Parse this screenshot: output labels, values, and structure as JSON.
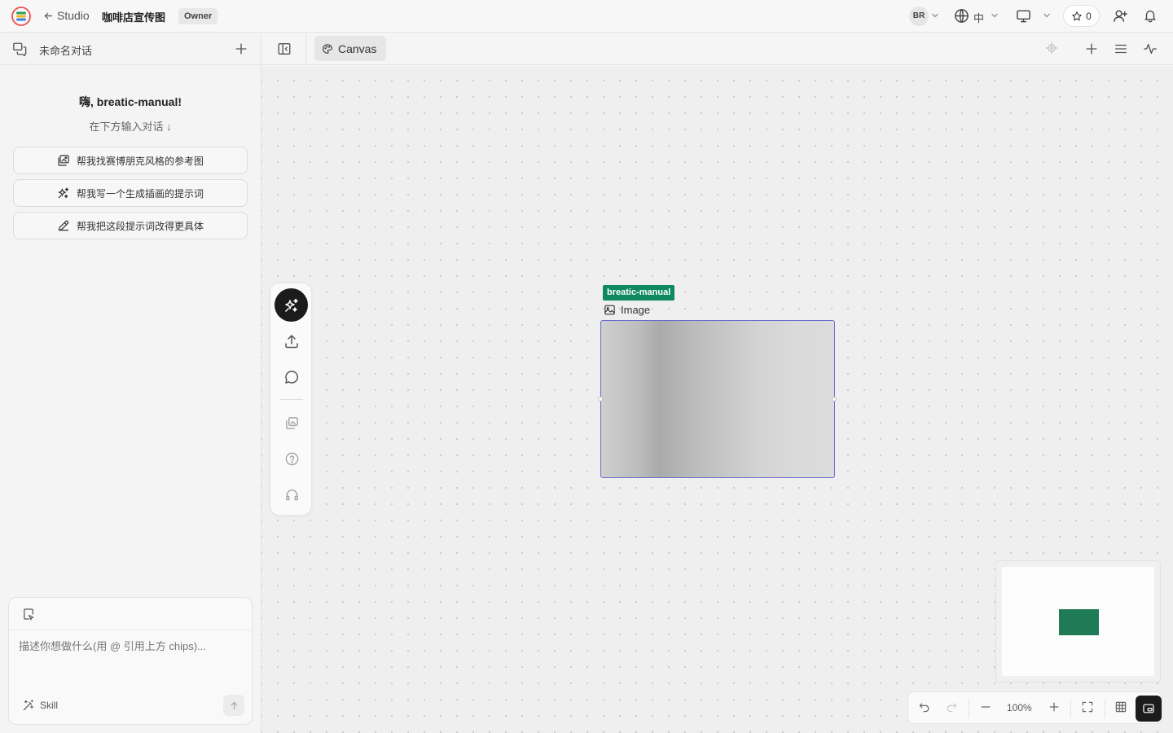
{
  "header": {
    "back_label": "Studio",
    "project_title": "咖啡店宣传图",
    "role_badge": "Owner",
    "user_initials": "BR",
    "language_label": "中",
    "star_count": "0"
  },
  "left_panel": {
    "conversation_title": "未命名对话",
    "greeting": "嗨, breatic-manual!",
    "hint": "在下方输入对话 ↓",
    "suggestions": [
      {
        "label": "帮我找赛博朋克风格的参考图",
        "icon": "image-search-icon"
      },
      {
        "label": "帮我写一个生成插画的提示词",
        "icon": "sparkles-icon"
      },
      {
        "label": "帮我把这段提示词改得更具体",
        "icon": "pencil-icon"
      }
    ],
    "chat_placeholder": "描述你想做什么(用 @ 引用上方 chips)...",
    "skill_label": "Skill"
  },
  "canvas_bar": {
    "tab_label": "Canvas"
  },
  "canvas": {
    "node": {
      "user_tag": "breatic-manual",
      "type_label": "Image"
    }
  },
  "bottom_bar": {
    "zoom_label": "100%"
  },
  "colors": {
    "node_tag": "#0f8a5f",
    "selection_border": "#6b6bd0",
    "minimap_node": "#1f7a56",
    "active_dark": "#1b1b1b"
  }
}
